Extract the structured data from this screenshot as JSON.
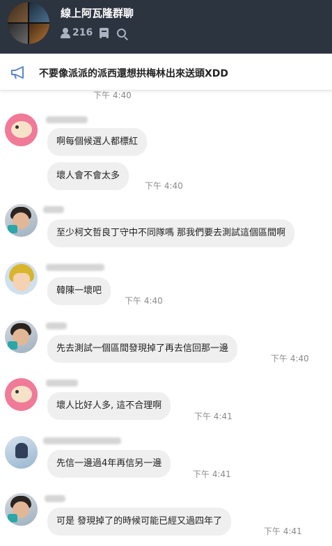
{
  "header": {
    "title": "線上阿瓦隆群聊",
    "member_count": "216",
    "bg_color": "#2c3440"
  },
  "announcement": {
    "text": "不要像派派的派西還想拱梅林出來送頭XDD",
    "icon": "megaphone-icon"
  },
  "top_time": "下午 4:40",
  "messages": [
    {
      "avatar": "pink-monkey",
      "bubbles": [
        {
          "text": "啊每個候選人都標紅"
        },
        {
          "text": "壞人會不會太多",
          "time": "下午 4:40"
        }
      ]
    },
    {
      "avatar": "photo",
      "bubbles": [
        {
          "text": "至少柯文哲良丁守中不同隊嗎 那我們要去測試這個區間啊"
        }
      ]
    },
    {
      "avatar": "anime",
      "bubbles": [
        {
          "text": "韓陳一壞吧",
          "time": "下午 4:40"
        }
      ]
    },
    {
      "avatar": "photo",
      "bubbles": [
        {
          "text": "先去測試一個區間發現掉了再去信回那一邊",
          "time": "下午 4:40"
        }
      ]
    },
    {
      "avatar": "pink-monkey",
      "bubbles": [
        {
          "text": "壞人比好人多, 這不合理啊",
          "time": "下午 4:41"
        }
      ]
    },
    {
      "avatar": "blue-photo",
      "bubbles": [
        {
          "text": "先信一邊過4年再信另一邊",
          "time": "下午 4:41"
        }
      ]
    },
    {
      "avatar": "photo",
      "bubbles": [
        {
          "text": "可是 發現掉了的時候可能已經又過四年了",
          "time": "下午 4:41"
        }
      ]
    }
  ]
}
